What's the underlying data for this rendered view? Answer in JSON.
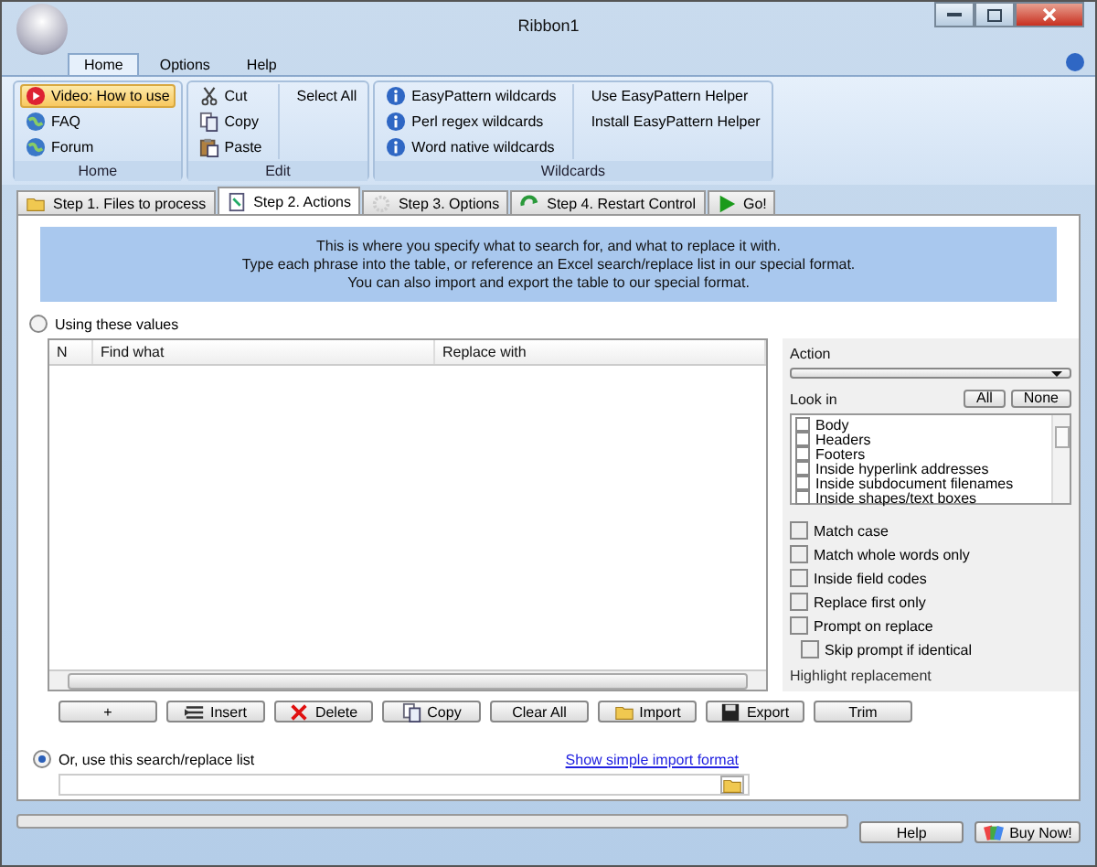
{
  "window": {
    "title": "Ribbon1"
  },
  "ribbon": {
    "tabs": [
      {
        "label": "Home",
        "selected": true
      },
      {
        "label": "Options",
        "selected": false
      },
      {
        "label": "Help",
        "selected": false
      }
    ],
    "groups": [
      {
        "label": "Home",
        "columns": [
          [
            {
              "label": "Video: How to use",
              "kind": "play",
              "highlighted": true
            },
            {
              "label": "FAQ",
              "kind": "globe",
              "highlighted": false
            },
            {
              "label": "Forum",
              "kind": "globe",
              "highlighted": false
            }
          ]
        ]
      },
      {
        "label": "Edit",
        "columns": [
          [
            {
              "label": "Cut",
              "kind": "scissors",
              "highlighted": false
            },
            {
              "label": "Copy",
              "kind": "copy",
              "highlighted": false
            },
            {
              "label": "Paste",
              "kind": "paste",
              "highlighted": false
            }
          ],
          [
            {
              "label": "Select All",
              "kind": "plain",
              "highlighted": false
            }
          ]
        ]
      },
      {
        "label": "Wildcards",
        "columns": [
          [
            {
              "label": "EasyPattern wildcards",
              "kind": "info",
              "highlighted": false
            },
            {
              "label": "Perl regex wildcards",
              "kind": "info",
              "highlighted": false
            },
            {
              "label": "Word native wildcards",
              "kind": "info",
              "highlighted": false
            }
          ],
          [
            {
              "label": "Use EasyPattern Helper",
              "kind": "plain",
              "highlighted": false
            },
            {
              "label": "Install EasyPattern Helper",
              "kind": "plain",
              "highlighted": false
            }
          ]
        ]
      }
    ]
  },
  "step_tabs": [
    {
      "label": "Step 1. Files to process",
      "kind": "folder",
      "selected": false
    },
    {
      "label": "Step 2. Actions",
      "kind": "doc",
      "selected": true
    },
    {
      "label": "Step 3. Options",
      "kind": "gear",
      "selected": false
    },
    {
      "label": "Step 4. Restart Control",
      "kind": "refresh",
      "selected": false
    },
    {
      "label": "Go!",
      "kind": "go",
      "selected": false
    }
  ],
  "banner": {
    "lines": [
      "This is where you specify what to search for, and what to replace it with.",
      "Type each phrase into the table, or reference an Excel search/replace list in our special format.",
      "You can also import and export the table to our special format."
    ]
  },
  "values_option": {
    "label": "Using these values",
    "selected": false
  },
  "table": {
    "columns": [
      "N",
      "Find what",
      "Replace with"
    ]
  },
  "action": {
    "label": "Action"
  },
  "look_in": {
    "label": "Look in",
    "buttons": [
      "All",
      "None"
    ],
    "items": [
      {
        "label": "Body",
        "checked": false
      },
      {
        "label": "Headers",
        "checked": false
      },
      {
        "label": "Footers",
        "checked": false
      },
      {
        "label": "Inside hyperlink addresses",
        "checked": false
      },
      {
        "label": "Inside subdocument filenames",
        "checked": false
      },
      {
        "label": "Inside shapes/text boxes",
        "checked": false
      }
    ]
  },
  "options": [
    {
      "label": "Match case",
      "checked": false,
      "kind": "main"
    },
    {
      "label": "Match whole words only",
      "checked": false,
      "kind": "main"
    },
    {
      "label": "Inside field codes",
      "checked": false,
      "kind": "main"
    },
    {
      "label": "Replace first only",
      "checked": false,
      "kind": "main"
    },
    {
      "label": "Prompt on replace",
      "checked": false,
      "kind": "main"
    },
    {
      "label": "Skip prompt if identical",
      "checked": false,
      "kind": "sub"
    }
  ],
  "highlight": {
    "label": "Highlight replacement"
  },
  "table_buttons": [
    {
      "label": "+",
      "kind": "plain"
    },
    {
      "label": "Insert",
      "kind": "insert"
    },
    {
      "label": "Delete",
      "kind": "cross"
    },
    {
      "label": "Copy",
      "kind": "copy"
    },
    {
      "label": "Clear All",
      "kind": "plain"
    },
    {
      "label": "Import",
      "kind": "folder"
    },
    {
      "label": "Export",
      "kind": "disk"
    },
    {
      "label": "Trim",
      "kind": "plain"
    }
  ],
  "list_option": {
    "label": "Or, use this search/replace list",
    "selected": true
  },
  "import_link": "Show simple import format",
  "progress": {
    "level": 0
  },
  "bottom_buttons": [
    {
      "label": "Help",
      "kind": "plain"
    },
    {
      "label": "Buy Now!",
      "kind": "cards"
    }
  ]
}
